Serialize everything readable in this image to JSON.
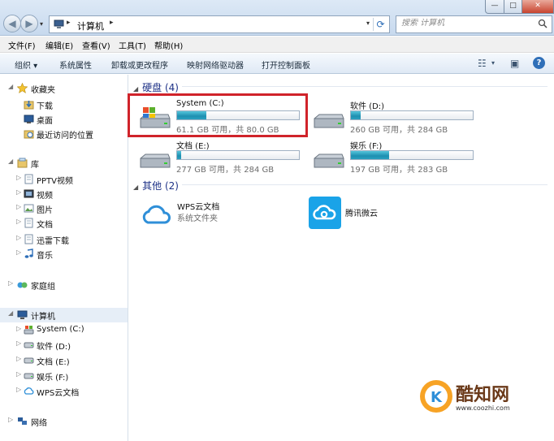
{
  "address": {
    "crumb": "计算机"
  },
  "search": {
    "placeholder": "搜索 计算机"
  },
  "menu": [
    "文件(F)",
    "编辑(E)",
    "查看(V)",
    "工具(T)",
    "帮助(H)"
  ],
  "toolbar": {
    "organize": "组织 ▾",
    "properties": "系统属性",
    "uninstall": "卸载或更改程序",
    "map_drive": "映射网络驱动器",
    "control_panel": "打开控制面板"
  },
  "sidebar": {
    "favorites": {
      "label": "收藏夹",
      "items": [
        "下载",
        "桌面",
        "最近访问的位置"
      ]
    },
    "libraries": {
      "label": "库",
      "items": [
        "PPTV视频",
        "视频",
        "图片",
        "文档",
        "迅雷下载",
        "音乐"
      ]
    },
    "homegroup": "家庭组",
    "computer": {
      "label": "计算机",
      "items": [
        "System (C:)",
        "软件 (D:)",
        "文档 (E:)",
        "娱乐 (F:)",
        "WPS云文档"
      ]
    },
    "network": "网络"
  },
  "hard_disks": {
    "header": "硬盘 (4)",
    "drives": [
      {
        "name": "System (C:)",
        "size_text": "61.1 GB 可用，共 80.0 GB",
        "used_fraction": 0.24
      },
      {
        "name": "软件 (D:)",
        "size_text": "260 GB 可用，共 284 GB",
        "used_fraction": 0.08
      },
      {
        "name": "文档 (E:)",
        "size_text": "277 GB 可用，共 284 GB",
        "used_fraction": 0.03
      },
      {
        "name": "娱乐 (F:)",
        "size_text": "197 GB 可用，共 283 GB",
        "used_fraction": 0.31
      }
    ]
  },
  "other": {
    "header": "其他 (2)",
    "items": [
      {
        "name": "WPS云文档",
        "sub": "系统文件夹"
      },
      {
        "name": "腾讯微云",
        "sub": ""
      }
    ]
  },
  "watermark": {
    "brand": "酷知网",
    "url": "www.coozhi.com"
  },
  "colors": {
    "highlight": "#d0232a",
    "drive_fill": "#2aa0c0",
    "group_header": "#1e3287"
  }
}
